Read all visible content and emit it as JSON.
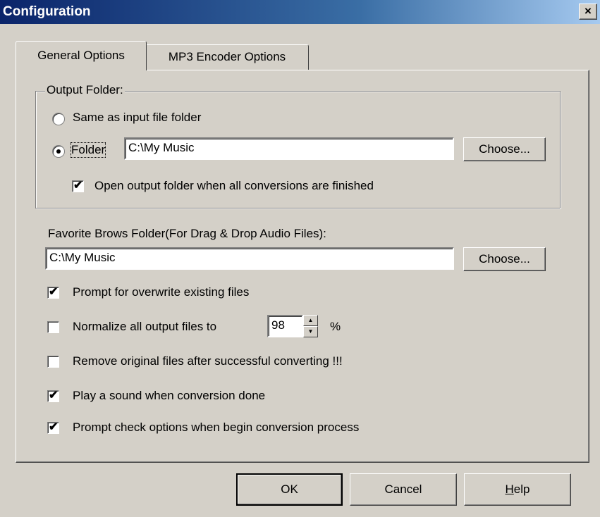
{
  "window": {
    "title": "Configuration",
    "close_glyph": "×"
  },
  "tabs": [
    {
      "label": "General Options",
      "active": true
    },
    {
      "label": "MP3 Encoder Options",
      "active": false
    }
  ],
  "output_folder": {
    "group_title": "Output Folder:",
    "same_as_input_label": "Same as input file folder",
    "same_as_input_selected": false,
    "folder_label": "Folder",
    "folder_selected": true,
    "folder_value": "C:\\My Music",
    "choose_label": "Choose...",
    "open_when_finished_label": "Open output folder when all conversions are finished",
    "open_when_finished_checked": true
  },
  "favorite": {
    "label": "Favorite Brows Folder(For Drag & Drop Audio Files):",
    "value": "C:\\My Music",
    "choose_label": "Choose..."
  },
  "options": {
    "prompt_overwrite": {
      "label": "Prompt for overwrite existing files",
      "checked": true
    },
    "normalize": {
      "label": "Normalize all output files to",
      "checked": false,
      "value": "98",
      "unit": "%"
    },
    "remove_original": {
      "label": "Remove original files after successful converting !!!",
      "checked": false
    },
    "play_sound": {
      "label": "Play a sound when conversion done",
      "checked": true
    },
    "prompt_check": {
      "label": "Prompt check options when begin conversion process",
      "checked": true
    }
  },
  "footer": {
    "ok": "OK",
    "cancel": "Cancel",
    "help_prefix": "H",
    "help_rest": "elp"
  },
  "icons": {
    "check": "✔",
    "spin_up": "▲",
    "spin_down": "▼"
  }
}
